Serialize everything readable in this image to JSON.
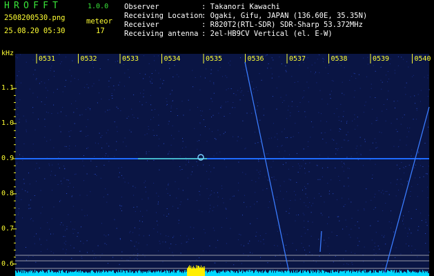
{
  "header": {
    "logo_text": "HROFFT",
    "version": "1.0.0",
    "filename": "2508200530.png",
    "mode_label": "meteor",
    "datetime": "25.08.20 05:30",
    "count": "17",
    "info": [
      {
        "label": "Observer",
        "value": ": Takanori Kawachi"
      },
      {
        "label": "Receiving Location",
        "value": ": Ogaki, Gifu, JAPAN (136.60E, 35.35N)"
      },
      {
        "label": "Receiver",
        "value": ": R820T2(RTL-SDR) SDR-Sharp 53.372MHz"
      },
      {
        "label": "Receiving antenna",
        "value": ": 2el-HB9CV Vertical (el. E-W)"
      }
    ]
  },
  "chart_data": {
    "type": "heatmap",
    "y_unit_label": "kHz",
    "x_ticks": [
      "0531",
      "0532",
      "0533",
      "0534",
      "0535",
      "0536",
      "0537",
      "0538",
      "0539",
      "0540"
    ],
    "y_ticks": [
      "1.1",
      "1.0",
      "0.9",
      "0.8",
      "0.7",
      "0.6"
    ],
    "ylim": [
      0.58,
      1.2
    ],
    "carrier_khz": 0.9,
    "background_color": "#081038",
    "signal_color": "#1e6cff",
    "level_bar_color": "#00d8ff",
    "peak_color": "#ffee00"
  }
}
